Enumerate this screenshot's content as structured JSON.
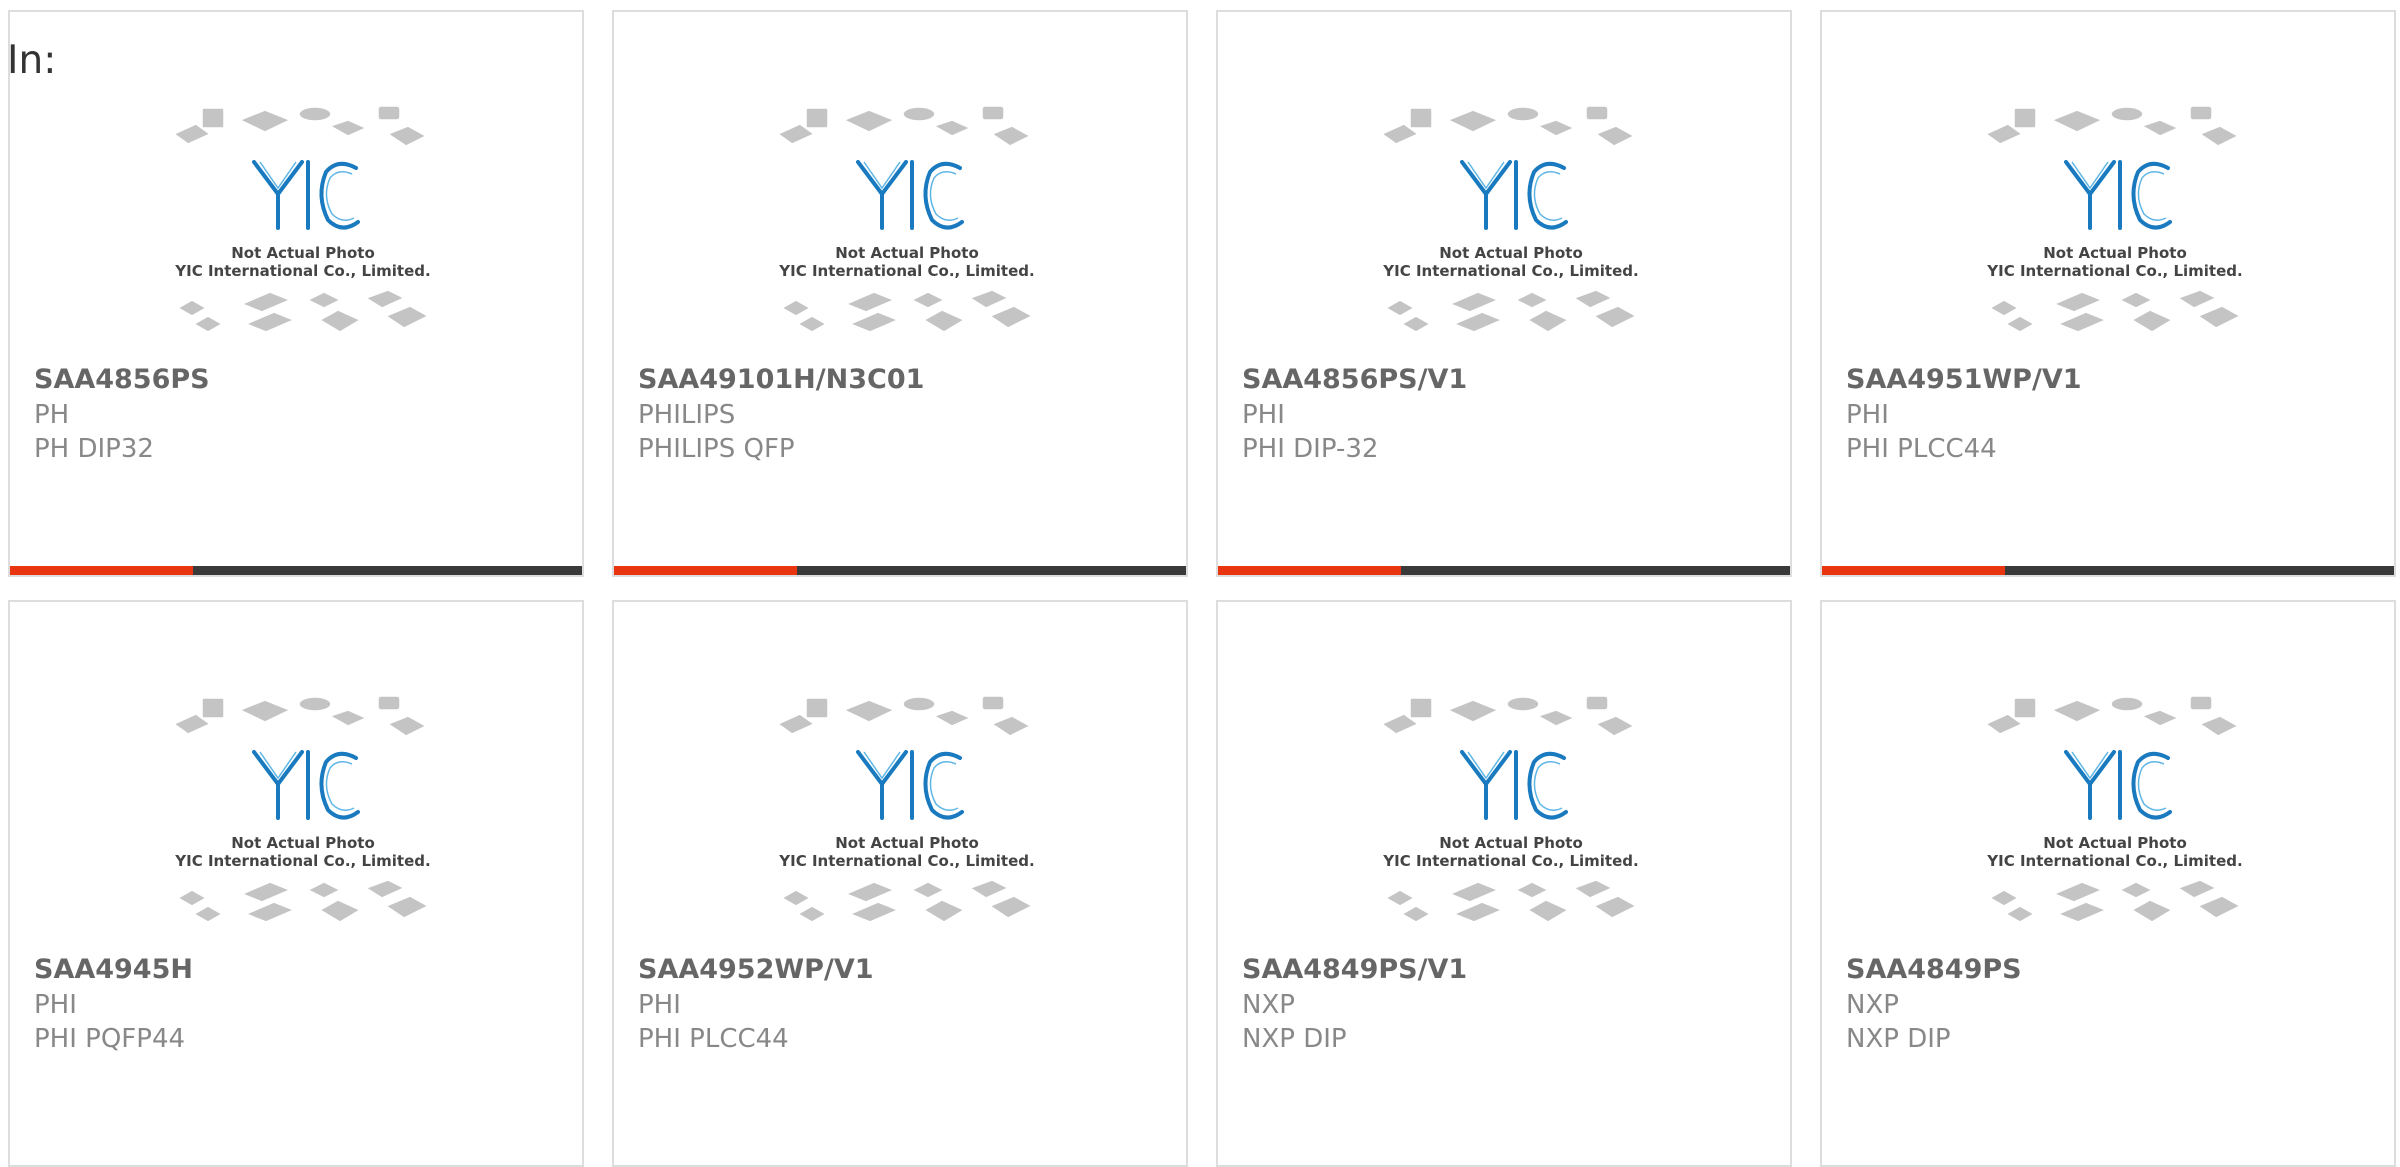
{
  "filter": {
    "label": "In:"
  },
  "theme": {
    "accent": "#e8350f",
    "bar_track": "#3a3a3a",
    "logo_blue": "#1a7abf"
  },
  "photo_caption": {
    "line1": "Not Actual Photo",
    "line2": "YIC International Co., Limited.",
    "logo_text": "YIC"
  },
  "products": [
    {
      "part": "SAA4856PS",
      "brand": "PH",
      "package": "PH DIP32",
      "bar_fill": 0.32
    },
    {
      "part": "SAA49101H/N3C01",
      "brand": "PHILIPS",
      "package": "PHILIPS QFP",
      "bar_fill": 0.32
    },
    {
      "part": "SAA4856PS/V1",
      "brand": "PHI",
      "package": "PHI DIP-32",
      "bar_fill": 0.32
    },
    {
      "part": "SAA4951WP/V1",
      "brand": "PHI",
      "package": "PHI PLCC44",
      "bar_fill": 0.32
    },
    {
      "part": "SAA4945H",
      "brand": "PHI",
      "package": "PHI PQFP44",
      "bar_fill": null
    },
    {
      "part": "SAA4952WP/V1",
      "brand": "PHI",
      "package": "PHI PLCC44",
      "bar_fill": null
    },
    {
      "part": "SAA4849PS/V1",
      "brand": "NXP",
      "package": "NXP DIP",
      "bar_fill": null
    },
    {
      "part": "SAA4849PS",
      "brand": "NXP",
      "package": "NXP DIP",
      "bar_fill": null
    }
  ]
}
